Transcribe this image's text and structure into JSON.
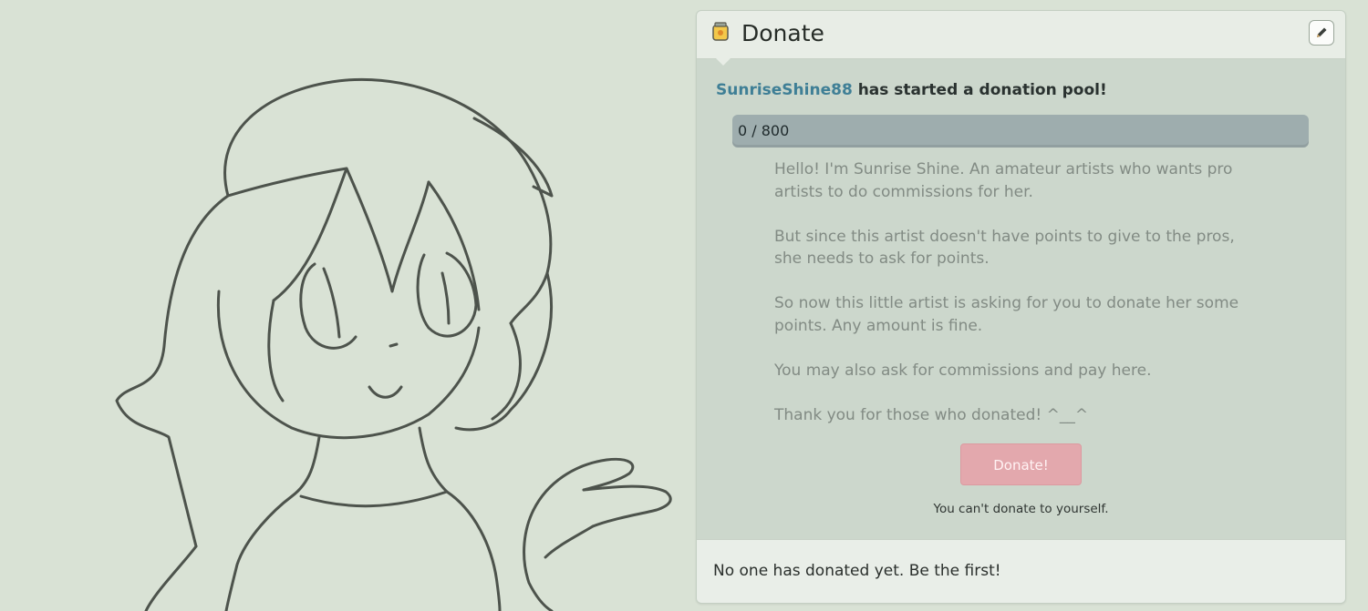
{
  "sketch": {
    "description_icon": "character-sketch"
  },
  "widget": {
    "title": "Donate",
    "icon": "jar-icon",
    "edit_icon": "pencil-icon",
    "pool_user": "SunriseShine88",
    "pool_text": " has started a donation pool!",
    "progress": {
      "label": "0 / 800",
      "current": 0,
      "goal": 800,
      "fraction": 0
    },
    "description": [
      "Hello! I'm Sunrise Shine. An amateur artists who wants pro artists to do commissions for her.",
      "But since this artist doesn't have points to give to the pros, she needs to ask for points.",
      "So now this little artist is asking for you to donate her some points. Any amount is fine.",
      "You may also ask for commissions and pay here.",
      "Thank you for those who donated! ^__^"
    ],
    "donate_button": "Donate!",
    "cant_donate": "You can't donate to yourself.",
    "footer": "No one has donated yet. Be the first!"
  },
  "colors": {
    "background": "#d9e2d5",
    "user_link": "#3f7f96",
    "donate_button": "#e3a8ad",
    "progress_track": "#9eadae"
  }
}
